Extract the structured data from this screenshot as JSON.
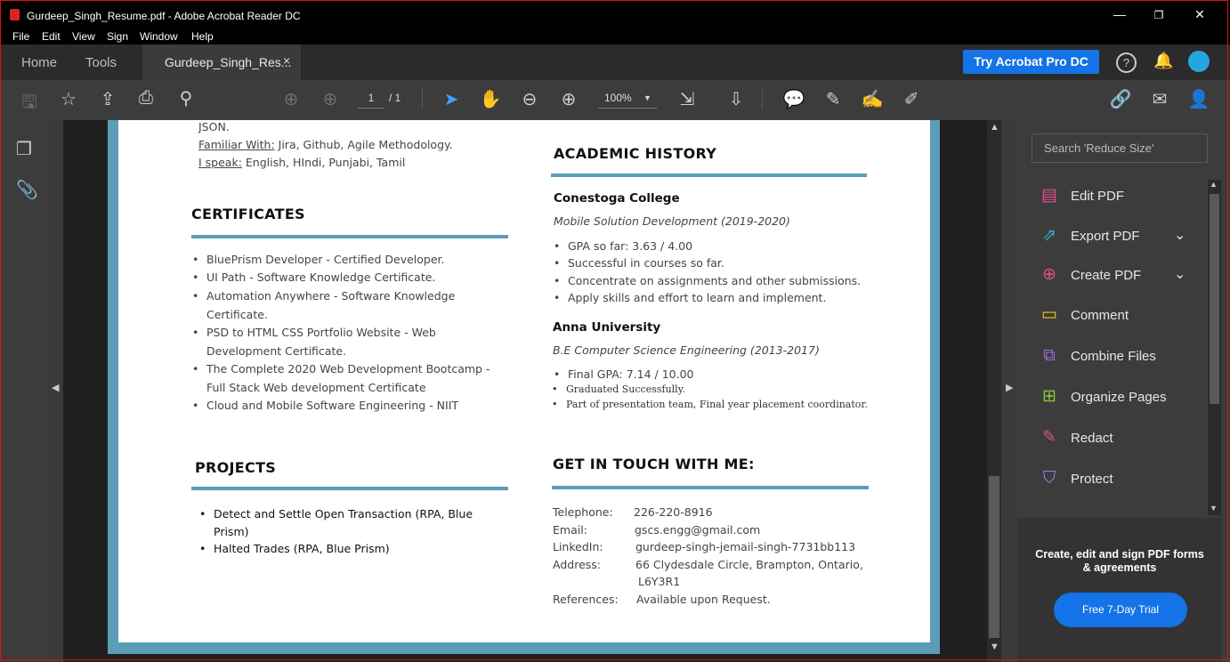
{
  "window": {
    "title": "Gurdeep_Singh_Resume.pdf - Adobe Acrobat Reader DC",
    "minimize": "—",
    "maximize": "❐",
    "close": "✕"
  },
  "menu": [
    "File",
    "Edit",
    "View",
    "Sign",
    "Window",
    "Help"
  ],
  "tabs": {
    "home": "Home",
    "tools": "Tools",
    "document": "Gurdeep_Singh_Res...",
    "close": "×"
  },
  "header": {
    "try_button": "Try Acrobat Pro DC",
    "help": "?"
  },
  "toolbar": {
    "page_current": "1",
    "page_total": "/ 1",
    "zoom": "100%"
  },
  "resume": {
    "top_lines": {
      "json": "JSON.",
      "familiar_label": "Familiar With:",
      "familiar_value": " Jira, Github, Agile Methodology.",
      "speak_label": "I speak:",
      "speak_value": " English, HIndi, Punjabi, Tamil"
    },
    "certificates": {
      "heading": "CERTIFICATES",
      "lines": [
        "BluePrism Developer - Certified Developer.",
        "UI Path - Software Knowledge Certificate.",
        "Automation Anywhere - Software Knowledge",
        "Certificate.",
        "PSD to HTML CSS Portfolio Website - Web",
        "Development Certificate.",
        "The Complete 2020 Web Development Bootcamp -",
        "Full Stack Web development Certificate",
        "Cloud and Mobile Software Engineering - NIIT"
      ]
    },
    "projects": {
      "heading": "PROJECTS",
      "lines": [
        "Detect and Settle Open Transaction (RPA, Blue",
        "Prism)",
        "Halted Trades (RPA, Blue Prism)"
      ]
    },
    "academic": {
      "heading": "ACADEMIC HISTORY",
      "school1": "Conestoga College",
      "program1": "Mobile Solution Development (2019-2020)",
      "items1": [
        "GPA so far: 3.63 / 4.00",
        "Successful in courses so far.",
        "Concentrate on assignments and other submissions.",
        "Apply skills and effort to learn and implement."
      ],
      "school2": "Anna University",
      "program2": "B.E Computer Science Engineering (2013-2017)",
      "item2_1": "Final GPA: 7.14 / 10.00",
      "item2_2": "Graduated Successfully.",
      "item2_3": "Part of presentation team, Final year placement coordinator."
    },
    "contact": {
      "heading": "GET IN TOUCH WITH ME:",
      "telephone_label": "Telephone:",
      "telephone": "226-220-8916",
      "email_label": "Email:",
      "email": "gscs.engg@gmail.com",
      "linkedin_label": "LinkedIn:",
      "linkedin": "gurdeep-singh-jemail-singh-7731bb113",
      "address_label": "Address:",
      "address1": "66 Clydesdale Circle, Brampton, Ontario,",
      "address2": "L6Y3R1",
      "references_label": "References:",
      "references": "Available upon Request."
    }
  },
  "right_pane": {
    "search_placeholder": "Search 'Reduce Size'",
    "tools": [
      {
        "label": "Edit PDF",
        "color": "#e0508a"
      },
      {
        "label": "Export PDF",
        "color": "#32b3c7"
      },
      {
        "label": "Create PDF",
        "color": "#e0508a"
      },
      {
        "label": "Comment",
        "color": "#f2c81d"
      },
      {
        "label": "Combine Files",
        "color": "#9b6cdb"
      },
      {
        "label": "Organize Pages",
        "color": "#8bc53f"
      },
      {
        "label": "Redact",
        "color": "#e0508a"
      },
      {
        "label": "Protect",
        "color": "#8a8cf0"
      }
    ],
    "promo_text": "Create, edit and sign PDF forms & agreements",
    "trial_button": "Free 7-Day Trial"
  },
  "colors": {
    "accent": "#1473e6",
    "page_border": "#5b9db7"
  }
}
